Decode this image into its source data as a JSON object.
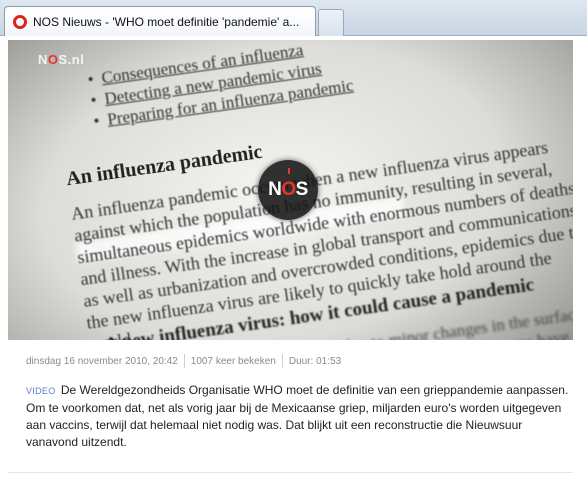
{
  "browser": {
    "tab_title": "NOS Nieuws - 'WHO moet definitie 'pandemie' a...",
    "accent": "#d9261c"
  },
  "video": {
    "watermark_prefix": "N",
    "watermark_o": "O",
    "watermark_suffix": "S.nl",
    "badge_prefix": "N",
    "badge_o": "O",
    "badge_suffix": "S",
    "frame": {
      "bullets": [
        "Consequences of an influenza",
        "Detecting a new pandemic virus",
        "Preparing for an influenza pandemic"
      ],
      "heading1": "An influenza pandemic",
      "para1": "An influenza pandemic occurs when a new influenza virus appears against which the population has no immunity, resulting in several, simultaneous epidemics worldwide with enormous numbers of deaths and illness. With the increase in global transport and communications, as well as urbanization and overcrowded conditions, epidemics due to the new influenza virus are likely to quickly take hold around the world.",
      "heading2": "A new influenza virus: how it could cause a pandemic",
      "para2": "Annual outbreaks of influenza are due to minor changes in the surface proteins that enable the viruses to evade the immunity humans have developed in response to vaccinations. When a major change occurs, no one will have protection."
    }
  },
  "meta": {
    "date": "dinsdag 16 november 2010, 20:42",
    "views": "1007 keer bekeken",
    "duration": "Duur: 01:53"
  },
  "description": {
    "tag": "VIDEO",
    "text": "De Wereldgezondheids Organisatie WHO moet de definitie van een grieppandemie aanpassen. Om te voorkomen dat, net als vorig jaar bij de Mexicaanse griep, miljarden euro's worden uitgegeven aan vaccins, terwijl dat helemaal niet nodig was. Dat blijkt uit een reconstructie die Nieuwsuur vanavond uitzendt."
  }
}
